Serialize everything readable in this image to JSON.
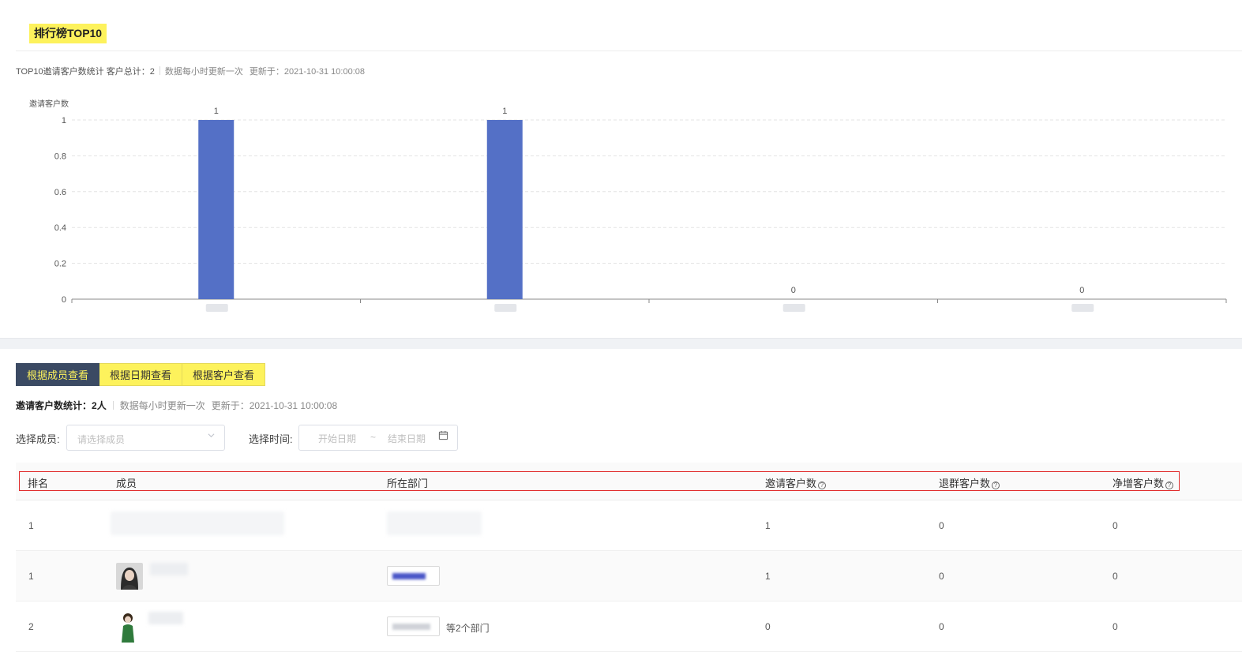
{
  "header": {
    "title": "排行榜TOP10",
    "stat_prefix": "TOP10邀请客户数统计 客户总计：",
    "stat_total": "2",
    "update_note": "数据每小时更新一次",
    "updated_at": "更新于：2021-10-31 10:00:08"
  },
  "chart_data": {
    "type": "bar",
    "ylabel": "邀请客户数",
    "ylim": [
      0,
      1
    ],
    "yticks": [
      "0",
      "0.2",
      "0.4",
      "0.6",
      "0.8",
      "1"
    ],
    "categories": [
      "",
      "",
      "",
      ""
    ],
    "values": [
      1,
      1,
      0,
      0
    ],
    "data_labels": [
      "1",
      "1",
      "0",
      "0"
    ],
    "bar_color": "#5470c6",
    "grid": true
  },
  "tabs": [
    {
      "label": "根据成员查看",
      "active": true
    },
    {
      "label": "根据日期查看",
      "active": false
    },
    {
      "label": "根据客户查看",
      "active": false
    }
  ],
  "summary": {
    "label": "邀请客户数统计：",
    "value": "2人",
    "update_note": "数据每小时更新一次",
    "updated_at": "更新于：2021-10-31 10:00:08"
  },
  "filters": {
    "member_label": "选择成员:",
    "member_placeholder": "请选择成员",
    "time_label": "选择时间:",
    "start_placeholder": "开始日期",
    "range_sep": "~",
    "end_placeholder": "结束日期"
  },
  "table": {
    "columns": [
      "排名",
      "成员",
      "所在部门",
      "邀请客户数",
      "退群客户数",
      "净增客户数"
    ],
    "rows": [
      {
        "rank": "1",
        "dept_suffix": "",
        "invited": "1",
        "left": "0",
        "net": "0"
      },
      {
        "rank": "1",
        "dept_suffix": "",
        "invited": "1",
        "left": "0",
        "net": "0"
      },
      {
        "rank": "2",
        "dept_suffix": "等2个部门",
        "invited": "0",
        "left": "0",
        "net": "0"
      }
    ]
  },
  "colors": {
    "accent_yellow": "#fdf25c",
    "tab_active_bg": "#3b4a63",
    "header_outline": "#e02a2a"
  }
}
